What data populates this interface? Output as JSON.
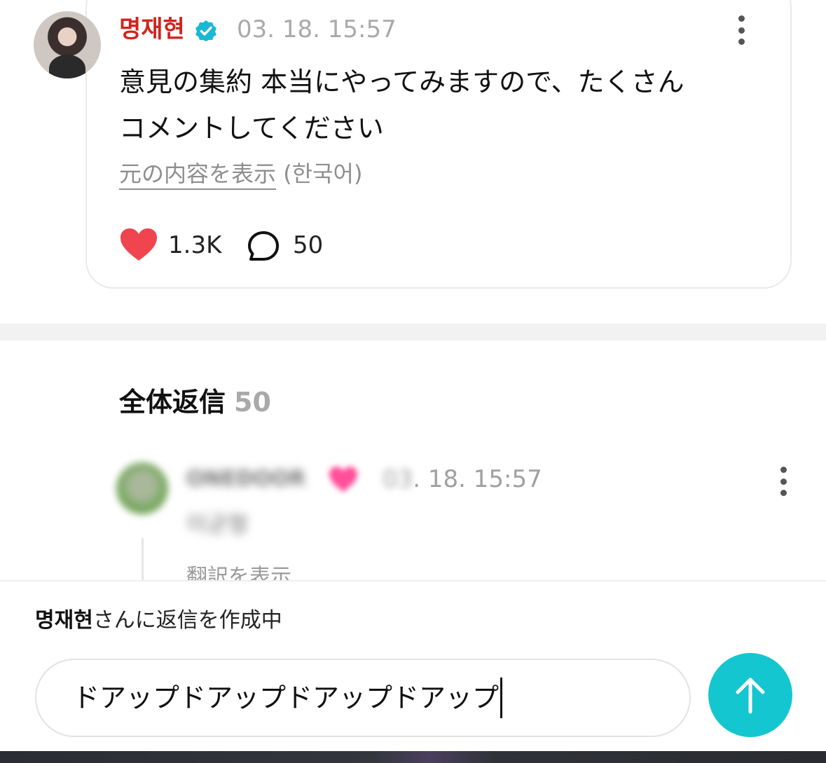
{
  "post": {
    "author": "명재현",
    "timestamp": "03. 18. 15:57",
    "text": "意見の集約 本当にやってみますので、たくさん\nコメントしてください",
    "original_link": "元の内容を表示",
    "original_lang": "(한국어)",
    "likes": "1.3K",
    "comments": "50"
  },
  "replies": {
    "title": "全体返信",
    "count": "50",
    "items": [
      {
        "author": "ONEDOOR",
        "timestamp_prefix": "03",
        "timestamp_suffix": ". 18. 15:57",
        "text": "이균형",
        "translate_label": "翻訳を表示"
      }
    ]
  },
  "composer": {
    "replying_to_name": "명재현",
    "replying_to_suffix": "さんに返信を作成中",
    "input_value": "ドアップドアップドアップドアップ"
  },
  "colors": {
    "author_red": "#d0251f",
    "verified_blue": "#19b8d4",
    "heart_red": "#f0444f",
    "send_teal": "#14c6d0"
  },
  "icons": {
    "verified": "verified-badge-icon",
    "like": "heart-icon",
    "comment": "comment-bubble-icon",
    "more": "more-vertical-icon",
    "send": "arrow-up-icon"
  }
}
